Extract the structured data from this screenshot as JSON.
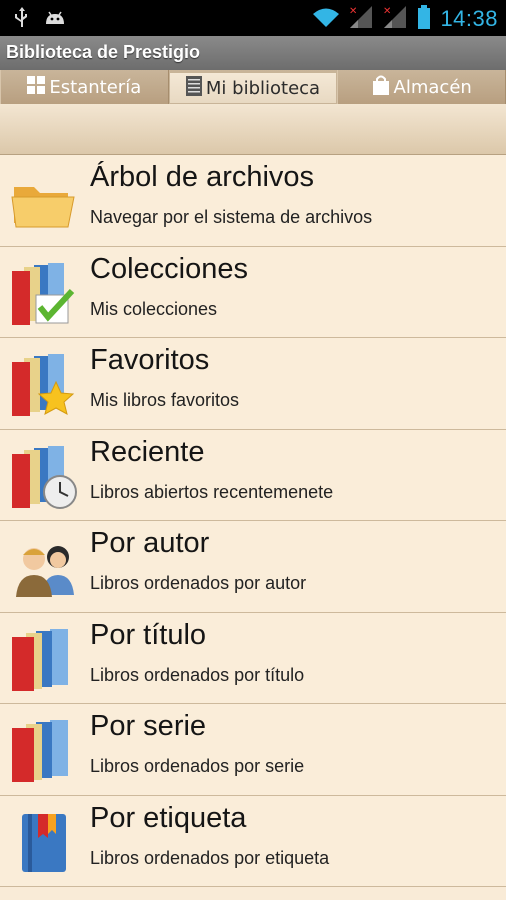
{
  "status_bar": {
    "time": "14:38",
    "icons": [
      "usb-icon",
      "android-icon",
      "wifi-icon",
      "signal-icon-1",
      "signal-icon-2",
      "battery-icon"
    ]
  },
  "app": {
    "title": "Biblioteca de Prestigio"
  },
  "tabs": [
    {
      "label": "Estantería",
      "icon": "grid-icon",
      "active": false
    },
    {
      "label": "Mi biblioteca",
      "icon": "list-icon",
      "active": true
    },
    {
      "label": "Almacén",
      "icon": "bag-icon",
      "active": false
    }
  ],
  "items": [
    {
      "title": "Árbol de archivos",
      "subtitle": "Navegar por el sistema de archivos",
      "icon": "folder-icon"
    },
    {
      "title": "Colecciones",
      "subtitle": "Mis colecciones",
      "icon": "books-check-icon"
    },
    {
      "title": "Favoritos",
      "subtitle": "Mis libros favoritos",
      "icon": "books-star-icon"
    },
    {
      "title": "Reciente",
      "subtitle": "Libros abiertos recentemenete",
      "icon": "books-clock-icon"
    },
    {
      "title": "Por autor",
      "subtitle": "Libros ordenados por autor",
      "icon": "authors-icon"
    },
    {
      "title": "Por título",
      "subtitle": "Libros ordenados por título",
      "icon": "books-icon"
    },
    {
      "title": "Por serie",
      "subtitle": "Libros ordenados por serie",
      "icon": "books-series-icon"
    },
    {
      "title": "Por etiqueta",
      "subtitle": "Libros ordenados por etiqueta",
      "icon": "tagged-book-icon"
    }
  ]
}
